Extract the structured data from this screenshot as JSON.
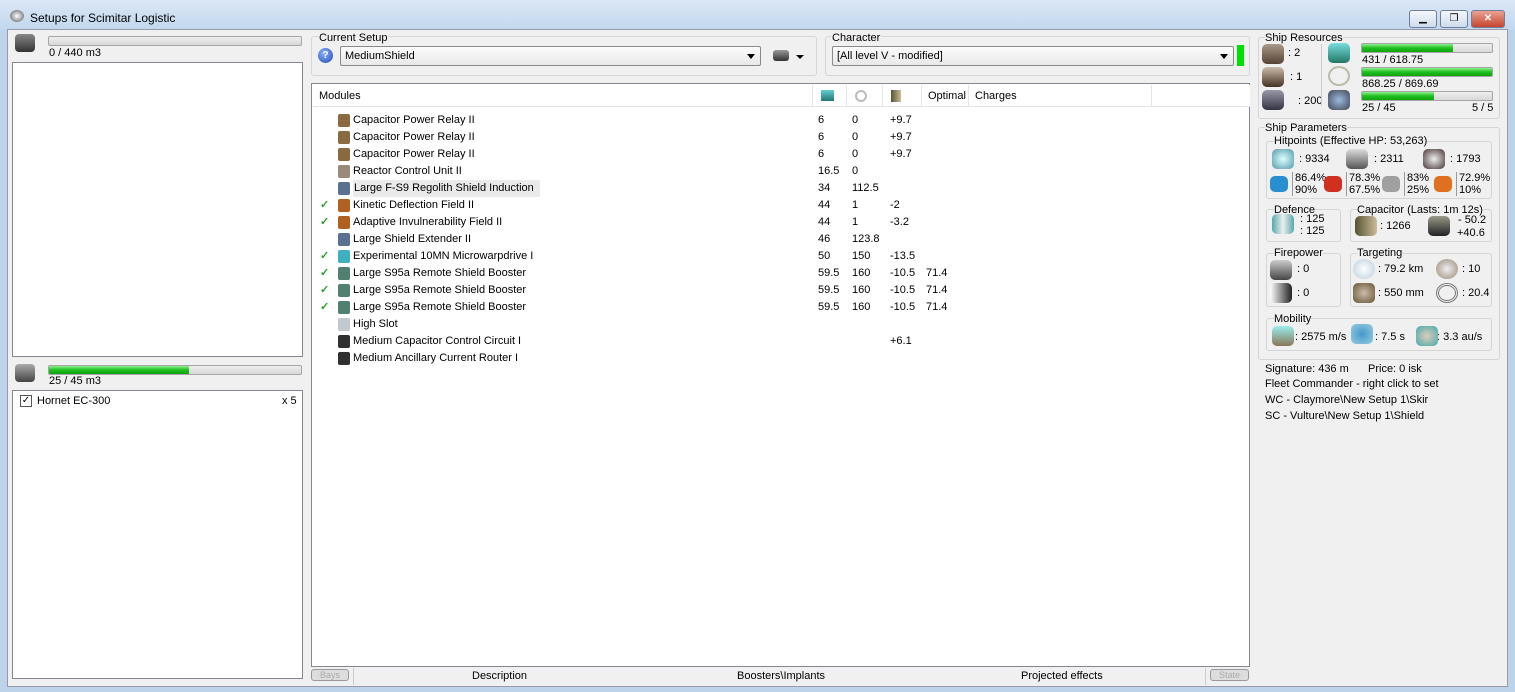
{
  "window": {
    "title": "Setups for Scimitar Logistic",
    "min": "▁",
    "max": "❐",
    "close": "✕"
  },
  "cargo": {
    "used": "0 / 440 m3",
    "fill": 0
  },
  "drones": {
    "used": "25 / 45 m3",
    "fill": 0.556,
    "items": [
      {
        "name": "Hornet EC-300",
        "qty": "x 5",
        "checked": true
      }
    ]
  },
  "setup": {
    "label": "Current Setup",
    "value": "MediumShield",
    "help": "?"
  },
  "character": {
    "label": "Character",
    "value": "[All level V - modified]",
    "status_color": "#00e000"
  },
  "modules": {
    "headers": [
      "Modules",
      "",
      "",
      "",
      "Optimal",
      "Charges"
    ],
    "rows": [
      {
        "active": false,
        "name": "Capacitor Power Relay II",
        "cpu": "6",
        "pg": "0",
        "cap": "+9.7",
        "optimal": "",
        "color": "#8a6a40"
      },
      {
        "active": false,
        "name": "Capacitor Power Relay II",
        "cpu": "6",
        "pg": "0",
        "cap": "+9.7",
        "optimal": "",
        "color": "#8a6a40"
      },
      {
        "active": false,
        "name": "Capacitor Power Relay II",
        "cpu": "6",
        "pg": "0",
        "cap": "+9.7",
        "optimal": "",
        "color": "#8a6a40"
      },
      {
        "active": false,
        "name": "Reactor Control Unit II",
        "cpu": "16.5",
        "pg": "0",
        "cap": "",
        "optimal": "",
        "color": "#9a8a7a"
      },
      {
        "active": false,
        "name": "Large F-S9 Regolith Shield Induction",
        "cpu": "34",
        "pg": "112.5",
        "cap": "",
        "optimal": "",
        "color": "#5a7090",
        "hl": true
      },
      {
        "active": true,
        "name": "Kinetic Deflection Field II",
        "cpu": "44",
        "pg": "1",
        "cap": "-2",
        "optimal": "",
        "color": "#b06020"
      },
      {
        "active": true,
        "name": "Adaptive Invulnerability Field II",
        "cpu": "44",
        "pg": "1",
        "cap": "-3.2",
        "optimal": "",
        "color": "#b06020"
      },
      {
        "active": false,
        "name": "Large Shield Extender II",
        "cpu": "46",
        "pg": "123.8",
        "cap": "",
        "optimal": "",
        "color": "#5a7090"
      },
      {
        "active": true,
        "name": "Experimental 10MN Microwarpdrive I",
        "cpu": "50",
        "pg": "150",
        "cap": "-13.5",
        "optimal": "",
        "color": "#40b0c0"
      },
      {
        "active": true,
        "name": "Large S95a Remote Shield Booster",
        "cpu": "59.5",
        "pg": "160",
        "cap": "-10.5",
        "optimal": "71.4",
        "color": "#508070"
      },
      {
        "active": true,
        "name": "Large S95a Remote Shield Booster",
        "cpu": "59.5",
        "pg": "160",
        "cap": "-10.5",
        "optimal": "71.4",
        "color": "#508070"
      },
      {
        "active": true,
        "name": "Large S95a Remote Shield Booster",
        "cpu": "59.5",
        "pg": "160",
        "cap": "-10.5",
        "optimal": "71.4",
        "color": "#508070"
      },
      {
        "active": false,
        "name": "High Slot",
        "cpu": "",
        "pg": "",
        "cap": "",
        "optimal": "",
        "color": "#c0c8d0"
      },
      {
        "active": false,
        "name": "Medium Capacitor Control Circuit I",
        "cpu": "",
        "pg": "",
        "cap": "+6.1",
        "optimal": "",
        "color": "#303030"
      },
      {
        "active": false,
        "name": "Medium Ancillary Current Router I",
        "cpu": "",
        "pg": "",
        "cap": "",
        "optimal": "",
        "color": "#303030"
      }
    ]
  },
  "bottom_tabs": {
    "bays": "Bays",
    "description": "Description",
    "boosters": "Boosters\\Implants",
    "projected": "Projected effects",
    "state": "State"
  },
  "resources": {
    "title": "Ship Resources",
    "turrets": ": 2",
    "launchers": ": 1",
    "calibration": ": 200",
    "cpu": "431 / 618.75",
    "cpu_fill": 0.697,
    "pg": "868.25 / 869.69",
    "pg_fill": 0.998,
    "drone_bw": "25 / 45",
    "drone_fill": 0.556,
    "drones_active": "5 / 5"
  },
  "params": {
    "title": "Ship Parameters",
    "hp_title": "Hitpoints (Effective HP: 53,263)",
    "shield": ": 9334",
    "armor": ": 2311",
    "hull": ": 1793",
    "resists": [
      {
        "a": "86.4%",
        "b": "90%",
        "color": "#2a8fd0"
      },
      {
        "a": "78.3%",
        "b": "67.5%",
        "color": "#d03020"
      },
      {
        "a": "83%",
        "b": "25%",
        "color": "#a0a0a0"
      },
      {
        "a": "72.9%",
        "b": "10%",
        "color": "#e07020"
      }
    ],
    "defence_title": "Defence",
    "def1": ": 125",
    "def2": ": 125",
    "cap_title": "Capacitor (Lasts: 1m 12s)",
    "cap_amount": ": 1266",
    "cap_use": "- 50.2",
    "cap_regen": "+40.6",
    "fire_title": "Firepower",
    "fire1": ": 0",
    "fire2": ": 0",
    "target_title": "Targeting",
    "range": ": 79.2 km",
    "targets": ": 10",
    "sensor": ": 550 mm",
    "scan": ": 20.4",
    "mob_title": "Mobility",
    "speed": ": 2575 m/s",
    "align": ": 7.5 s",
    "warp": ": 3.3 au/s",
    "signature": "Signature: 436 m",
    "price": "Price: 0 isk",
    "fleet": "Fleet Commander - right click to set",
    "wc": "WC - Claymore\\New Setup 1\\Skir",
    "sc": "SC - Vulture\\New Setup 1\\Shield"
  }
}
